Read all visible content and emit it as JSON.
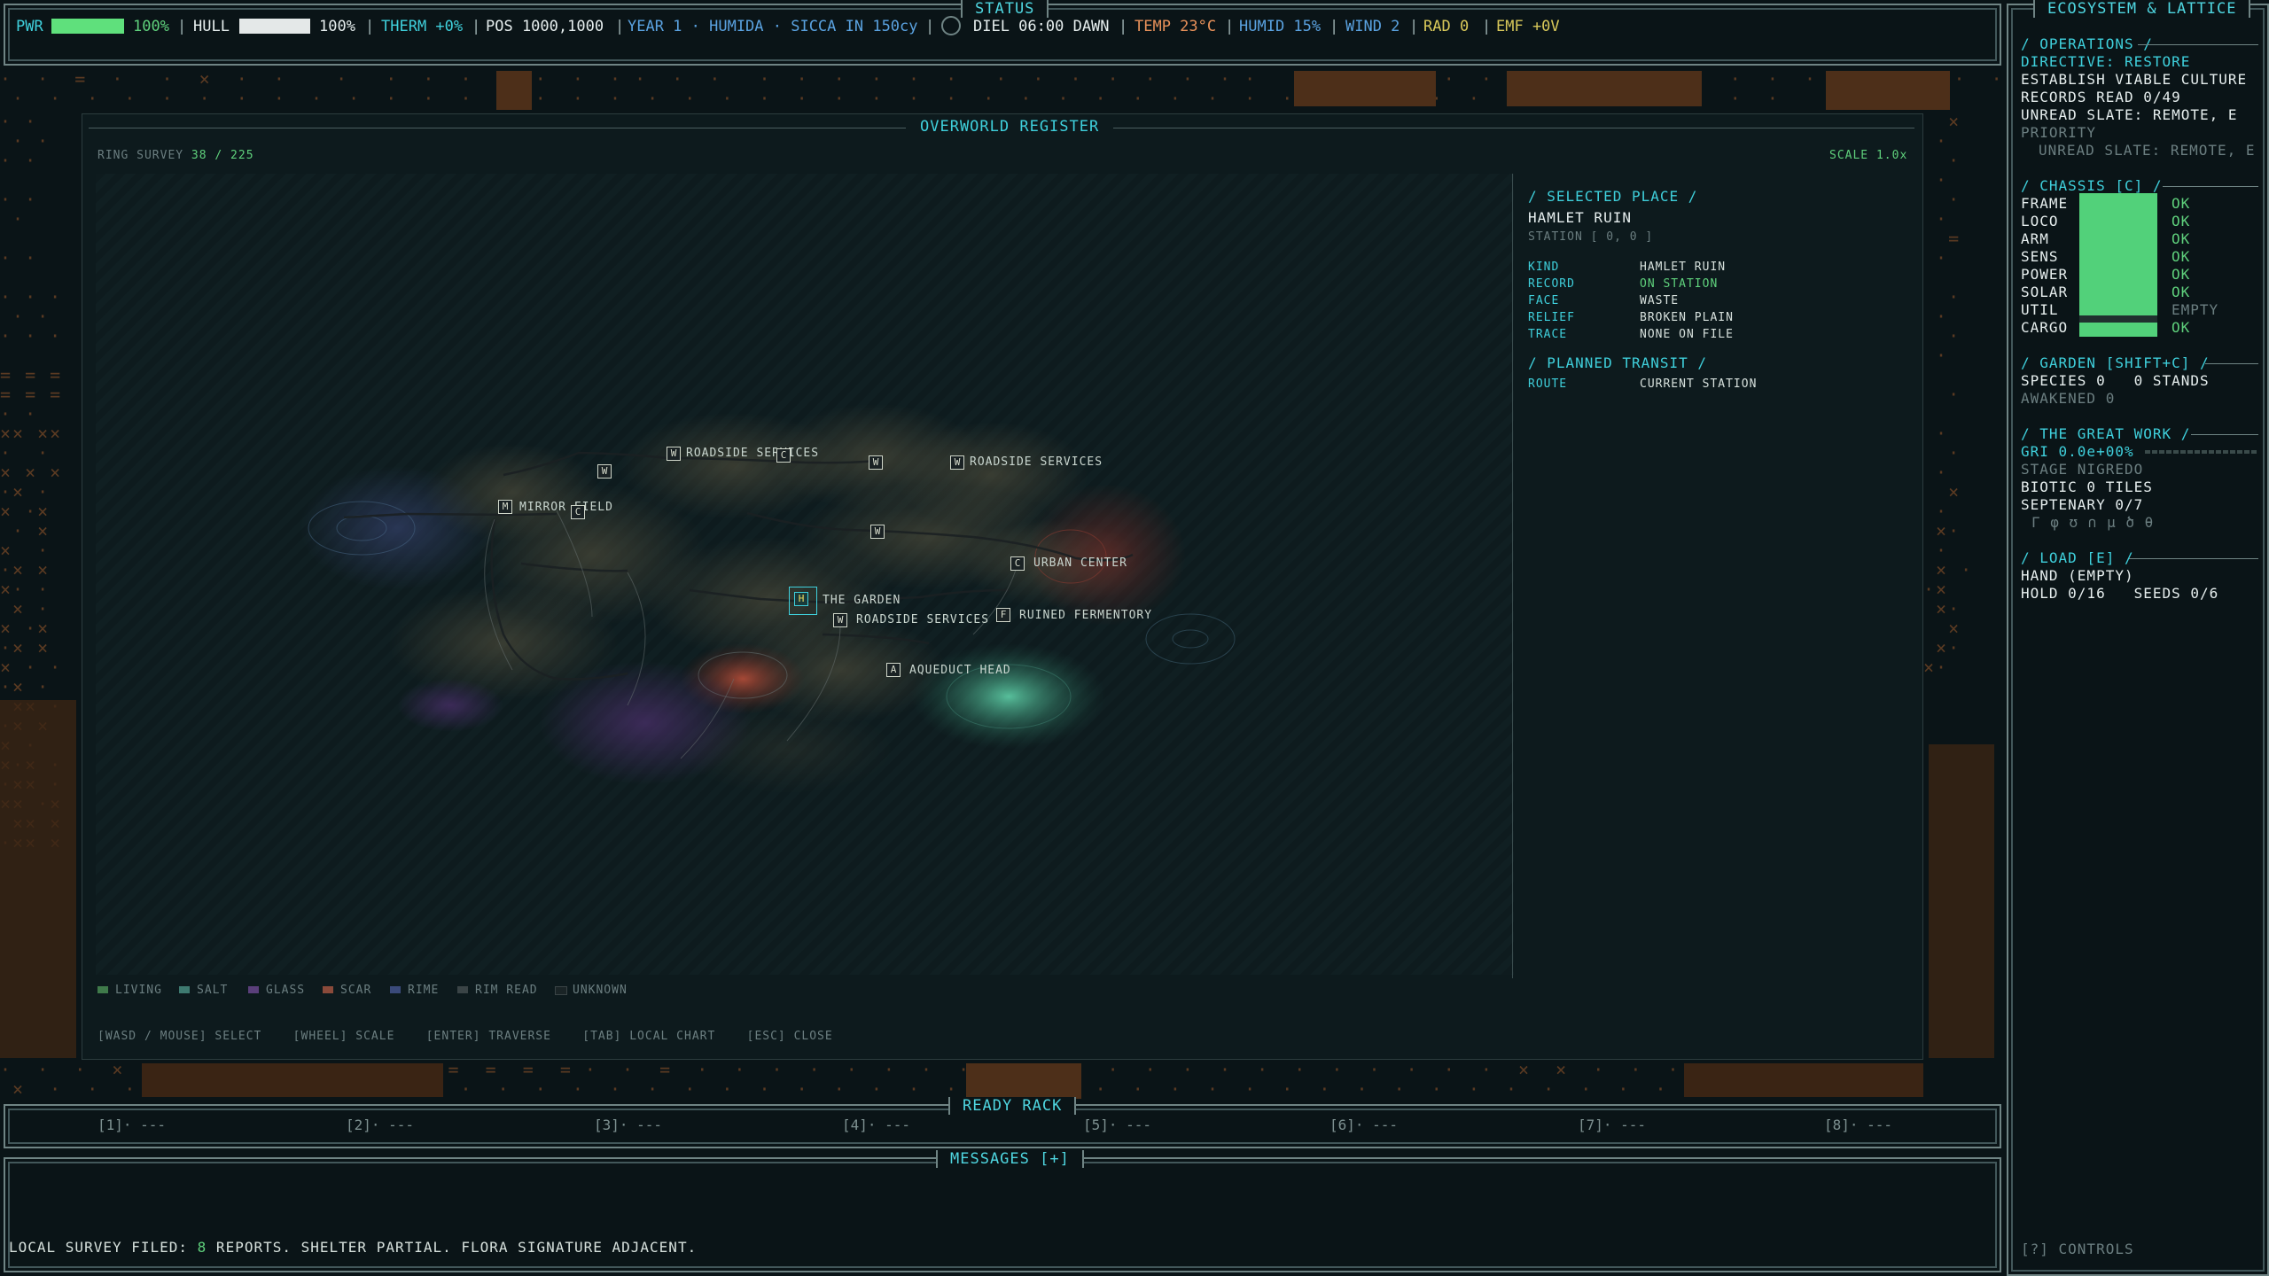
{
  "status": {
    "title": "STATUS",
    "pwr_label": "PWR",
    "pwr_value": "100%",
    "hull_label": "HULL",
    "hull_value": "100%",
    "therm": "THERM +0%",
    "pos": "POS 1000,1000",
    "calendar": "YEAR 1 · HUMIDA · SICCA IN 150cy",
    "diel": "DIEL 06:00 DAWN",
    "temp": "TEMP 23°C",
    "humid": "HUMID 15%",
    "wind": "WIND 2",
    "rad": "RAD 0",
    "emf": "EMF +0V",
    "pwr_level": 1.0,
    "hull_level": 1.0
  },
  "register": {
    "title": "OVERWORLD REGISTER",
    "survey_label": "RING SURVEY",
    "survey_value": "38 / 225",
    "scale": "SCALE 1.0x",
    "nodes": [
      {
        "glyph": "W",
        "label": "ROADSIDE SERVICES"
      },
      {
        "glyph": "W",
        "label": "ROADSIDE SERVICES"
      },
      {
        "glyph": "M",
        "label": "MIRROR FIELD"
      },
      {
        "glyph": "C",
        "label": "URBAN CENTER"
      },
      {
        "glyph": "H",
        "label": "THE GARDEN"
      },
      {
        "glyph": "W",
        "label": "ROADSIDE SERVICES"
      },
      {
        "glyph": "F",
        "label": "RUINED FERMENTORY"
      },
      {
        "glyph": "A",
        "label": "AQUEDUCT HEAD"
      },
      {
        "glyph": "W",
        "label": ""
      },
      {
        "glyph": "C",
        "label": ""
      },
      {
        "glyph": "W",
        "label": ""
      },
      {
        "glyph": "W",
        "label": ""
      },
      {
        "glyph": "C",
        "label": ""
      }
    ],
    "legend": [
      {
        "label": "LIVING",
        "color": "#3f7a4a"
      },
      {
        "label": "SALT",
        "color": "#3e7a70"
      },
      {
        "label": "GLASS",
        "color": "#5a3f7a"
      },
      {
        "label": "SCAR",
        "color": "#8a4a3a"
      },
      {
        "label": "RIME",
        "color": "#3a4a7a"
      },
      {
        "label": "RIM READ",
        "color": "#3a4446"
      },
      {
        "label": "UNKNOWN",
        "color": "#1a2426"
      }
    ],
    "hints": "[WASD / MOUSE] SELECT    [WHEEL] SCALE    [ENTER] TRAVERSE    [TAB] LOCAL CHART    [ESC] CLOSE",
    "selected": {
      "heading": "/ SELECTED PLACE /",
      "name": "HAMLET RUIN",
      "station": "STATION [ 0, 0 ]",
      "rows": [
        {
          "k": "KIND",
          "v": "HAMLET RUIN"
        },
        {
          "k": "RECORD",
          "v": "ON STATION"
        },
        {
          "k": "FACE",
          "v": "WASTE"
        },
        {
          "k": "RELIEF",
          "v": "BROKEN PLAIN"
        },
        {
          "k": "TRACE",
          "v": "NONE ON FILE"
        }
      ],
      "transit_heading": "/ PLANNED TRANSIT /",
      "route_k": "ROUTE",
      "route_v": "CURRENT STATION"
    }
  },
  "side": {
    "title": "ECOSYSTEM & LATTICE",
    "ops_heading": "/ OPERATIONS /",
    "directive": "DIRECTIVE: RESTORE",
    "goal": "ESTABLISH VIABLE CULTURE",
    "records": "RECORDS READ 0/49",
    "unread": "UNREAD SLATE: REMOTE, E",
    "priority": "PRIORITY",
    "priority_item": "UNREAD SLATE: REMOTE, E",
    "chassis_heading": "/ CHASSIS [C] /",
    "chassis": [
      {
        "part": "FRAME",
        "state": "OK",
        "level": 1.0
      },
      {
        "part": "LOCO",
        "state": "OK",
        "level": 1.0
      },
      {
        "part": "ARM",
        "state": "OK",
        "level": 1.0
      },
      {
        "part": "SENS",
        "state": "OK",
        "level": 1.0
      },
      {
        "part": "POWER",
        "state": "OK",
        "level": 1.0
      },
      {
        "part": "SOLAR",
        "state": "OK",
        "level": 1.0
      },
      {
        "part": "UTIL",
        "state": "EMPTY",
        "level": 0.0
      },
      {
        "part": "CARGO",
        "state": "OK",
        "level": 1.0
      }
    ],
    "garden_heading": "/ GARDEN [SHIFT+C] /",
    "species": "SPECIES 0   0 STANDS",
    "awakened": "AWAKENED 0",
    "work_heading": "/ THE GREAT WORK /",
    "gri": "GRI 0.0e+00%",
    "stage": "STAGE NIGREDO",
    "biotic": "BIOTIC 0 TILES",
    "septenary": "SEPTENARY 0/7",
    "glyphs": "Γ φ ʊ ∩ µ ծ θ",
    "load_heading": "/ LOAD [E] /",
    "hand": "HAND (EMPTY)",
    "hold": "HOLD 0/16   SEEDS 0/6",
    "controls": "[?] CONTROLS"
  },
  "rack": {
    "title": "READY RACK",
    "slots": [
      "[1]· ---",
      "[2]· ---",
      "[3]· ---",
      "[4]· ---",
      "[5]· ---",
      "[6]· ---",
      "[7]· ---",
      "[8]· ---"
    ]
  },
  "messages": {
    "title": "MESSAGES [+]",
    "line_prefix": "LOCAL SURVEY FILED: ",
    "line_count": "8",
    "line_suffix": " REPORTS. SHELTER PARTIAL. FLORA SIGNATURE ADJACENT."
  }
}
